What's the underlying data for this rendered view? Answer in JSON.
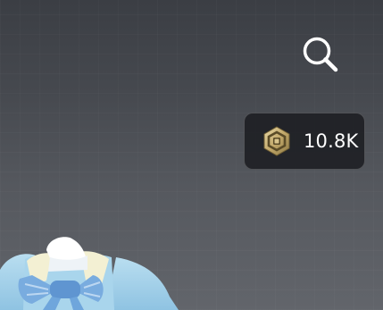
{
  "header": {
    "search_icon": "search-icon"
  },
  "currency": {
    "icon": "robux-coin-icon",
    "balance": "10.8K",
    "coin_color": "#c9b27a"
  },
  "avatar": {
    "outfit_colors": {
      "shirt": "#a8d3ea",
      "bow": "#6fa6dc",
      "collar": "#f3f0d3"
    }
  }
}
